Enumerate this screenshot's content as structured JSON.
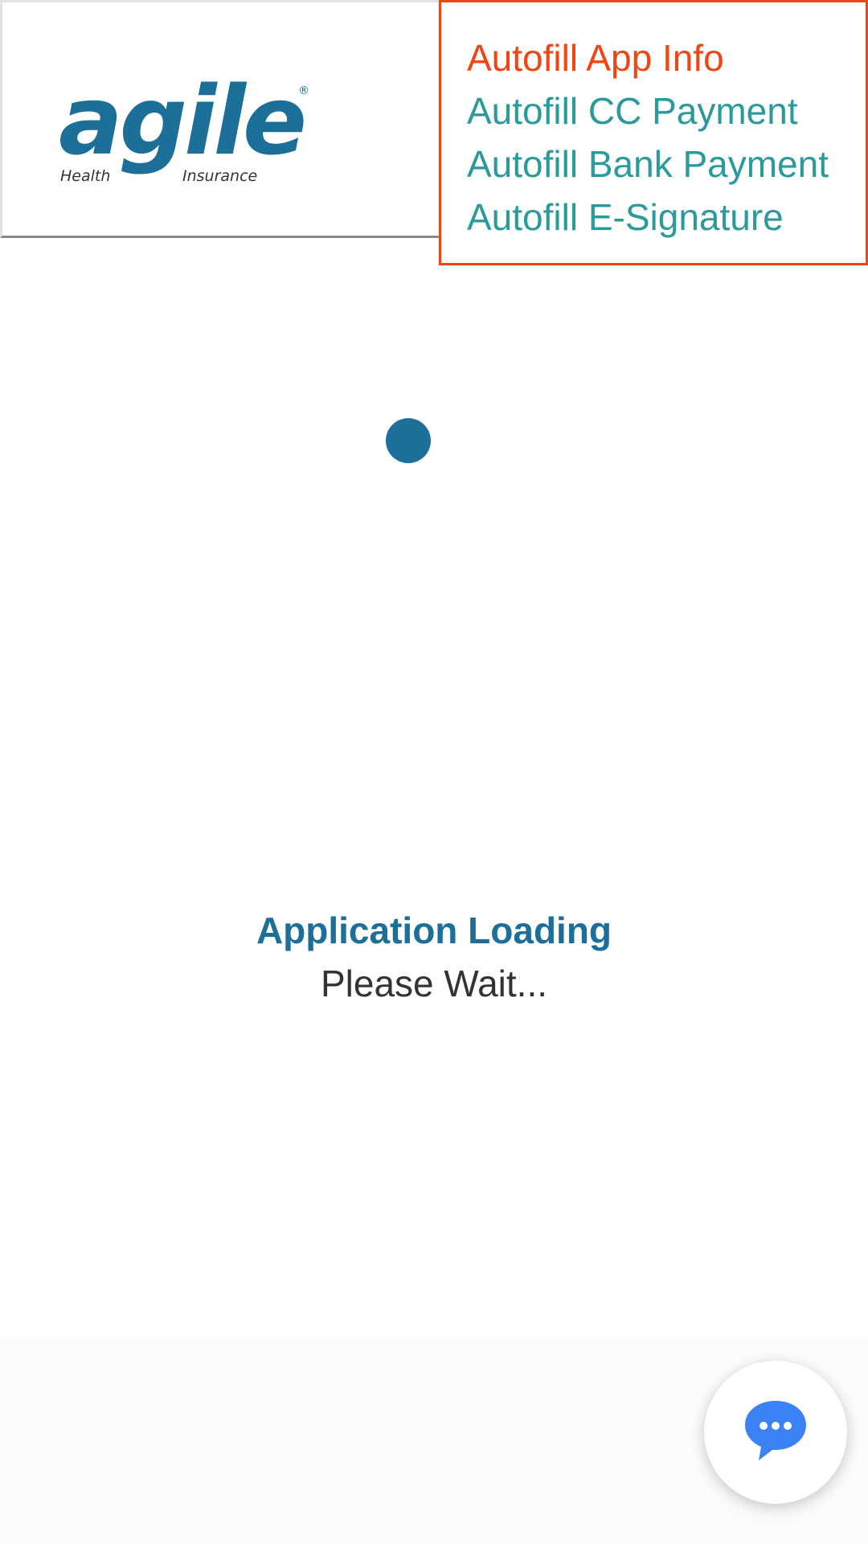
{
  "header": {
    "logo": {
      "word": "agile",
      "line_left": "Health",
      "line_right": "Insurance",
      "registered_mark": "®",
      "color": "#1b6f99"
    }
  },
  "autofill_menu": {
    "items": [
      {
        "label": "Autofill App Info",
        "active": true
      },
      {
        "label": "Autofill CC Payment",
        "active": false
      },
      {
        "label": "Autofill Bank Payment",
        "active": false
      },
      {
        "label": "Autofill E-Signature",
        "active": false
      }
    ],
    "active_color": "#ee4614",
    "item_color": "#2b9a9b"
  },
  "loading": {
    "title": "Application Loading",
    "subtitle": "Please Wait..."
  },
  "chat": {
    "icon": "chat-bubble-icon",
    "color": "#3b82f6"
  }
}
